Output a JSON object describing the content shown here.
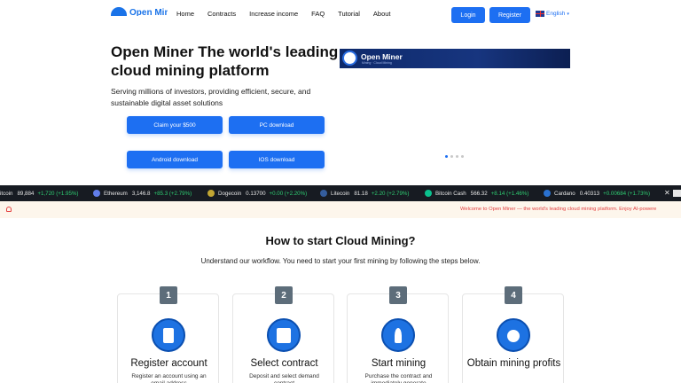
{
  "header": {
    "logo_text": "Open Miner",
    "nav": [
      "Home",
      "Contracts",
      "Increase income",
      "FAQ",
      "Tutorial",
      "About"
    ],
    "login_label": "Login",
    "register_label": "Register",
    "language": "English"
  },
  "hero": {
    "title": "Open Miner The world's leading cloud mining platform",
    "subtitle": "Serving millions of investors, providing efficient, secure, and sustainable digital asset solutions",
    "buttons": {
      "claim": "Claim your $500",
      "pc": "PC download",
      "android": "Android download",
      "ios": "IOS download"
    },
    "banner": {
      "title": "Open Miner",
      "tagline": "Mining · Cloud Mining"
    },
    "carousel": {
      "total": 4,
      "active": 1
    }
  },
  "ticker": {
    "items": [
      {
        "name": "itcoin",
        "price": "89,884",
        "change": "+1,720 (+1.95%)",
        "icon_color": "#f7931a"
      },
      {
        "name": "Ethereum",
        "price": "3,146.8",
        "change": "+85.3 (+2.79%)",
        "icon_color": "#627eea"
      },
      {
        "name": "Dogecoin",
        "price": "0.13700",
        "change": "+0.00 (+2.20%)",
        "icon_color": "#c2a633"
      },
      {
        "name": "Litecoin",
        "price": "81.18",
        "change": "+2.20 (+2.79%)",
        "icon_color": "#345d9d"
      },
      {
        "name": "Bitcoin Cash",
        "price": "566.32",
        "change": "+8.14 (+1.46%)",
        "icon_color": "#0ac18e"
      },
      {
        "name": "Cardano",
        "price": "0.40313",
        "change": "+0.00684 (+1.73%)",
        "icon_color": "#2a71d0"
      }
    ],
    "close_label": "✕",
    "positive_color": "#2ecc71"
  },
  "notice": {
    "text": "Welcome to Open Miner — the world's leading cloud mining platform. Enjoy AI-powere"
  },
  "how_to": {
    "title": "How to start Cloud Mining?",
    "subtitle": "Understand our workflow. You need to start your first mining by following the steps below.",
    "steps": [
      {
        "number": "1",
        "title": "Register account",
        "desc": "Register an account using an email address",
        "icon": "id-card-icon"
      },
      {
        "number": "2",
        "title": "Select contract",
        "desc": "Deposit and select demand contract",
        "icon": "contract-icon"
      },
      {
        "number": "3",
        "title": "Start mining",
        "desc": "Purchase the contract and immediately generate",
        "icon": "miner-icon"
      },
      {
        "number": "4",
        "title": "Obtain mining profits",
        "desc": "",
        "icon": "bitcoin-profit-icon"
      }
    ]
  }
}
